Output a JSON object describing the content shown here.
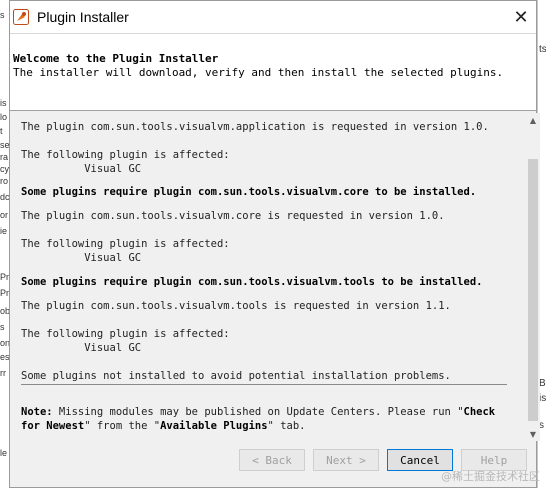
{
  "window": {
    "title": "Plugin Installer"
  },
  "header": {
    "title": "Welcome to the Plugin Installer",
    "subtitle": "The installer will download, verify and then install the selected plugins."
  },
  "content": {
    "lines": [
      "The plugin com.sun.tools.visualvm.application is requested in version 1.0.",
      "The following plugin is affected:",
      "          Visual GC",
      "Some plugins require plugin com.sun.tools.visualvm.core to be installed.",
      "The plugin com.sun.tools.visualvm.core is requested in version 1.0.",
      "The following plugin is affected:",
      "          Visual GC",
      "Some plugins require plugin com.sun.tools.visualvm.tools to be installed.",
      "The plugin com.sun.tools.visualvm.tools is requested in version 1.1.",
      "The following plugin is affected:",
      "          Visual GC",
      "Some plugins not installed to avoid potential installation problems."
    ],
    "note": {
      "label": "Note:",
      "text1": " Missing modules may be published on Update Centers. Please run \"",
      "link1": "Check for Newest",
      "text2": "\" from the \"",
      "link2": "Available Plugins",
      "text3": "\" tab."
    }
  },
  "buttons": {
    "back": "< Back",
    "next": "Next >",
    "cancel": "Cancel",
    "help": "Help"
  },
  "background": {
    "left_fragments": [
      "s",
      "is",
      "lo",
      "t",
      "se",
      "ra",
      "cy",
      "ro",
      "dc",
      "or",
      "ie",
      "Pr",
      "Pr",
      "ob",
      "s",
      "on",
      "es",
      "rr",
      "le"
    ],
    "right_fragments": [
      "ts",
      "B",
      "is",
      "s"
    ]
  },
  "watermark": "@稀土掘金技术社区",
  "colors": {
    "accent": "#0078d7",
    "disabled_text": "#a0a0a0"
  }
}
